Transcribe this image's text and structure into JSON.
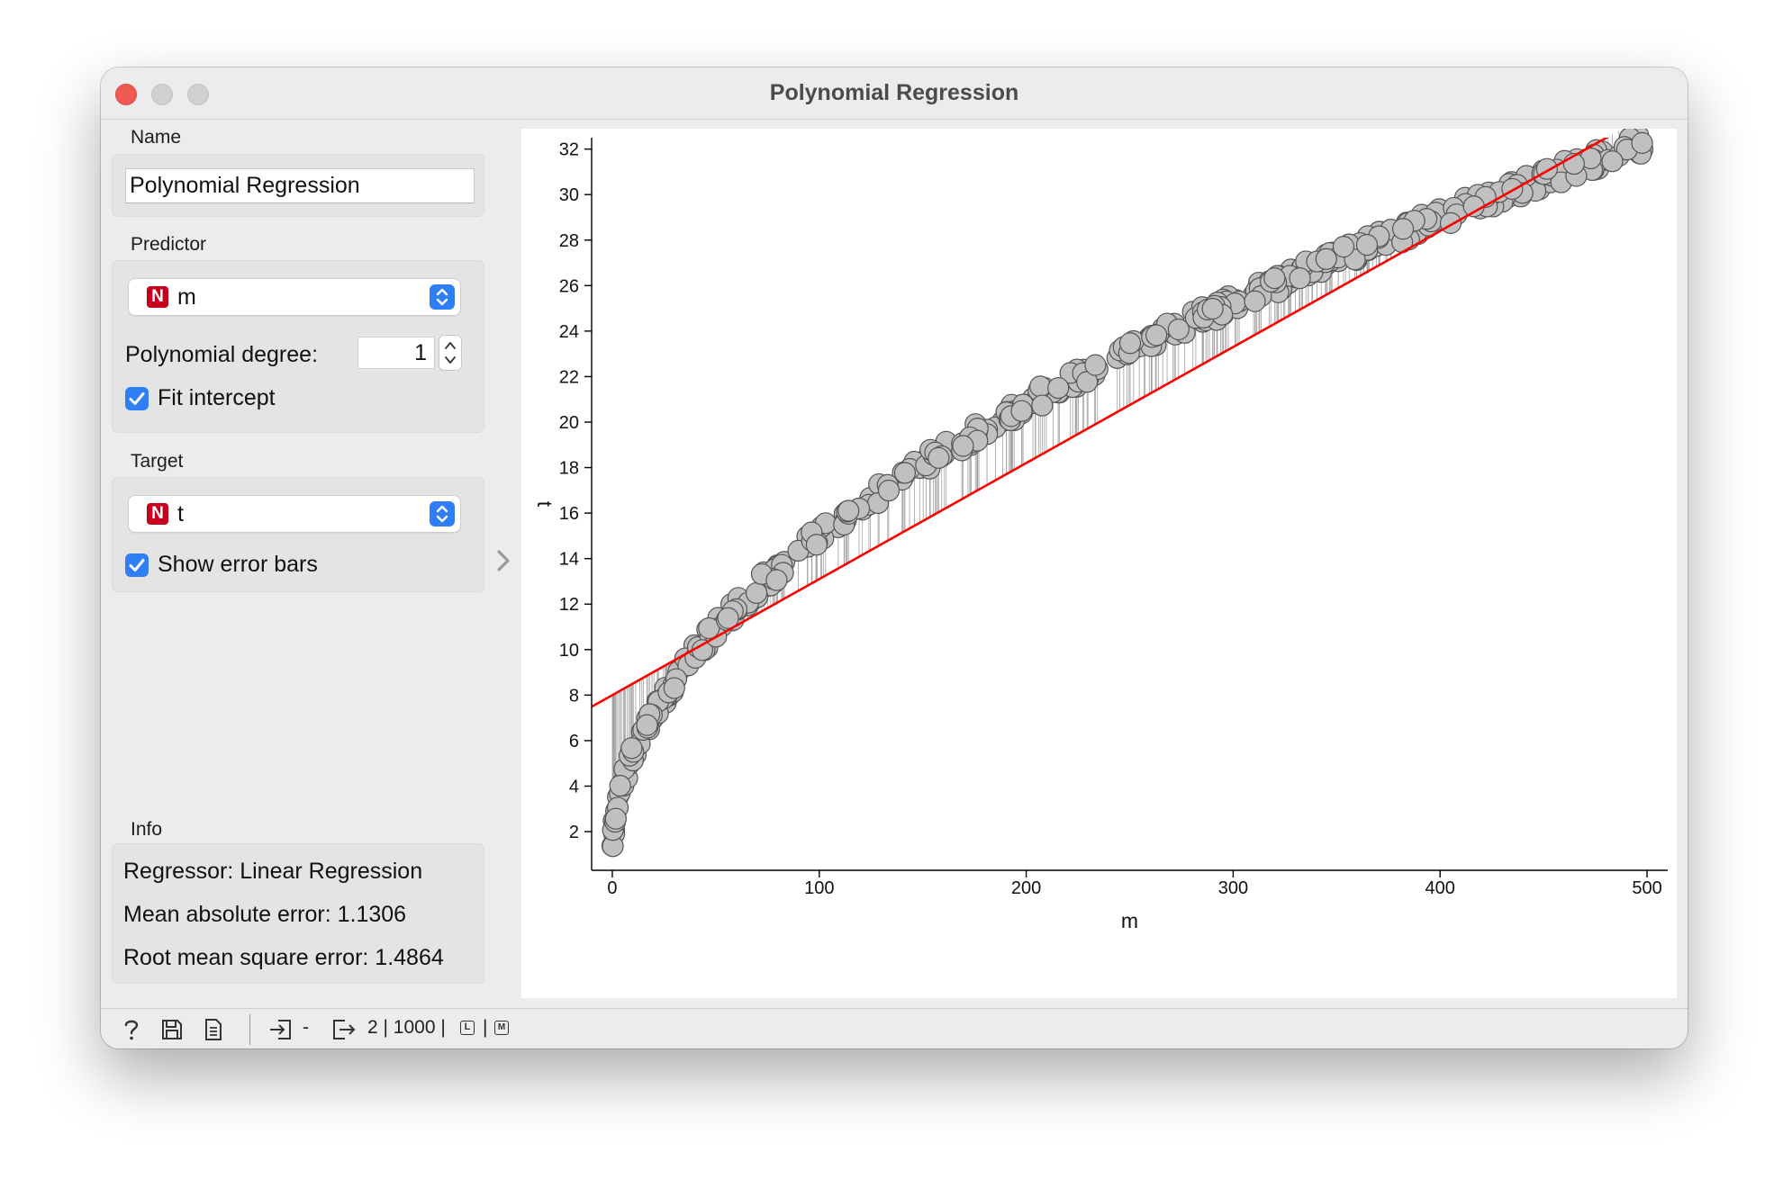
{
  "window": {
    "title": "Polynomial Regression"
  },
  "name_section": {
    "label": "Name",
    "value": "Polynomial Regression"
  },
  "predictor": {
    "label": "Predictor",
    "type_badge": "N",
    "selected": "m",
    "degree_label": "Polynomial degree:",
    "degree_value": "1",
    "fit_intercept_label": "Fit intercept",
    "fit_intercept_checked": true
  },
  "target": {
    "label": "Target",
    "type_badge": "N",
    "selected": "t",
    "error_bars_label": "Show error bars",
    "error_bars_checked": true
  },
  "info": {
    "label": "Info",
    "regressor": "Regressor: Linear Regression",
    "mae": "Mean absolute error: 1.1306",
    "rmse": "Root mean square error: 1.4864"
  },
  "statusbar": {
    "input_summary": "-",
    "output_summary": "2 | 1000 |",
    "sep": "|",
    "badge_l": "L",
    "badge_m": "M",
    "icons": [
      "help-icon",
      "save-icon",
      "report-icon",
      "input-icon",
      "output-icon"
    ]
  },
  "colors": {
    "accent": "#2f7ef6",
    "badge": "#c8001e",
    "fit_line": "#ff0000",
    "points_fill": "#c0c0c0",
    "points_stroke": "#555555",
    "error_bars": "#a0a0a0"
  },
  "chart_data": {
    "type": "scatter",
    "title": "",
    "xlabel": "m",
    "ylabel": "t",
    "xlim": [
      -10,
      510
    ],
    "ylim": [
      0.3,
      32.5
    ],
    "xticks": [
      0,
      100,
      200,
      300,
      400,
      500
    ],
    "yticks": [
      2,
      4,
      6,
      8,
      10,
      12,
      14,
      16,
      18,
      20,
      22,
      24,
      26,
      28,
      30,
      32
    ],
    "grid": false,
    "legend": "none",
    "fit_line": {
      "intercept": 8.0,
      "slope": 0.051,
      "x_range": [
        -10,
        510
      ]
    },
    "points": {
      "n": 1000,
      "x_range": [
        0,
        500
      ],
      "trend": "t ≈ 1.4 * sqrt(m) + 1",
      "sample": [
        [
          0,
          1.0
        ],
        [
          1,
          1.6
        ],
        [
          2,
          2.3
        ],
        [
          5,
          3.3
        ],
        [
          10,
          4.9
        ],
        [
          20,
          6.7
        ],
        [
          30,
          8.0
        ],
        [
          40,
          9.6
        ],
        [
          50,
          10.5
        ],
        [
          60,
          11.3
        ],
        [
          80,
          12.9
        ],
        [
          100,
          14.2
        ],
        [
          120,
          15.4
        ],
        [
          150,
          17.5
        ],
        [
          180,
          18.7
        ],
        [
          200,
          19.9
        ],
        [
          220,
          20.8
        ],
        [
          250,
          22.2
        ],
        [
          280,
          23.2
        ],
        [
          300,
          24.3
        ],
        [
          320,
          25.1
        ],
        [
          350,
          25.9
        ],
        [
          370,
          26.6
        ],
        [
          400,
          27.6
        ],
        [
          420,
          28.3
        ],
        [
          450,
          29.6
        ],
        [
          470,
          30.1
        ],
        [
          490,
          31.0
        ],
        [
          500,
          31.4
        ]
      ]
    }
  }
}
